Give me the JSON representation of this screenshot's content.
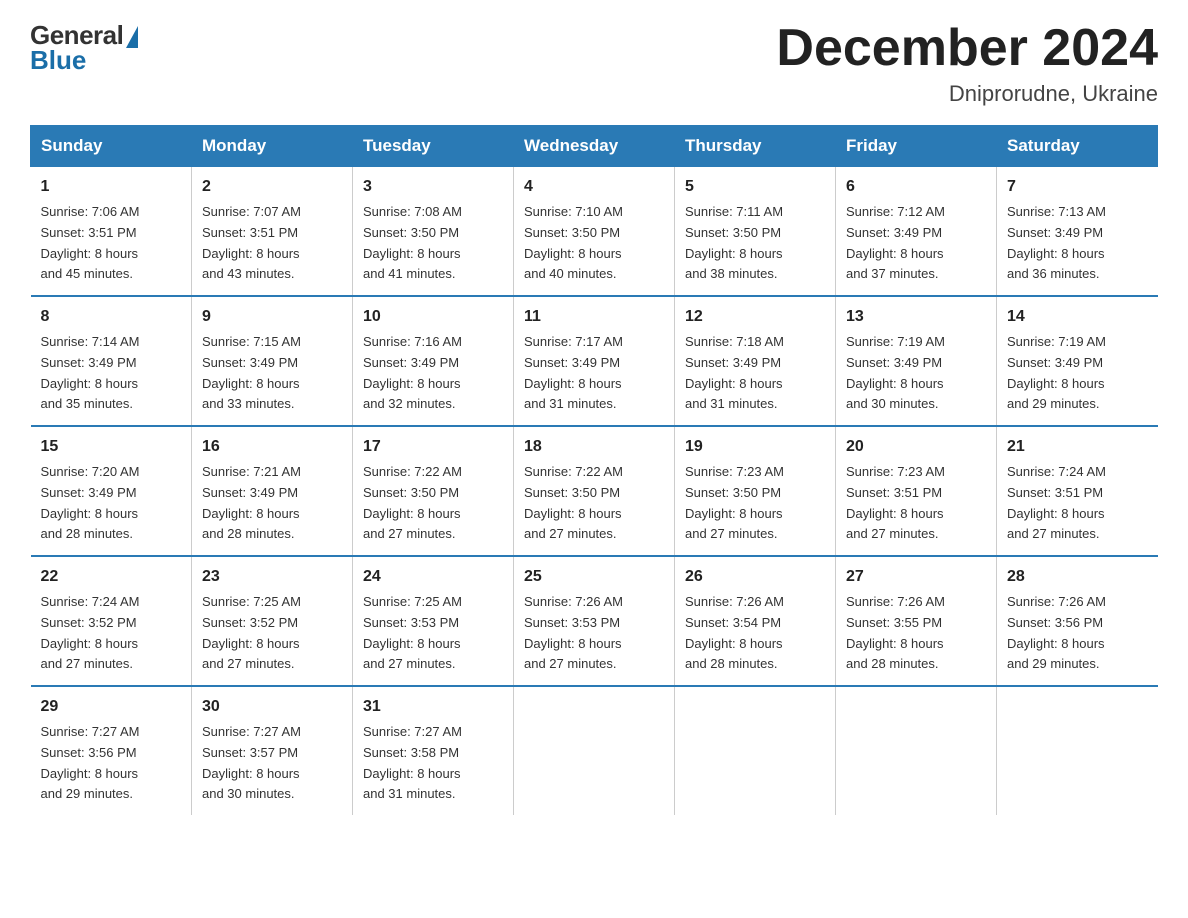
{
  "logo": {
    "general": "General",
    "blue": "Blue"
  },
  "header": {
    "month_year": "December 2024",
    "location": "Dniprorudne, Ukraine"
  },
  "days_of_week": [
    "Sunday",
    "Monday",
    "Tuesday",
    "Wednesday",
    "Thursday",
    "Friday",
    "Saturday"
  ],
  "weeks": [
    [
      {
        "day": "1",
        "sunrise": "7:06 AM",
        "sunset": "3:51 PM",
        "daylight": "8 hours and 45 minutes."
      },
      {
        "day": "2",
        "sunrise": "7:07 AM",
        "sunset": "3:51 PM",
        "daylight": "8 hours and 43 minutes."
      },
      {
        "day": "3",
        "sunrise": "7:08 AM",
        "sunset": "3:50 PM",
        "daylight": "8 hours and 41 minutes."
      },
      {
        "day": "4",
        "sunrise": "7:10 AM",
        "sunset": "3:50 PM",
        "daylight": "8 hours and 40 minutes."
      },
      {
        "day": "5",
        "sunrise": "7:11 AM",
        "sunset": "3:50 PM",
        "daylight": "8 hours and 38 minutes."
      },
      {
        "day": "6",
        "sunrise": "7:12 AM",
        "sunset": "3:49 PM",
        "daylight": "8 hours and 37 minutes."
      },
      {
        "day": "7",
        "sunrise": "7:13 AM",
        "sunset": "3:49 PM",
        "daylight": "8 hours and 36 minutes."
      }
    ],
    [
      {
        "day": "8",
        "sunrise": "7:14 AM",
        "sunset": "3:49 PM",
        "daylight": "8 hours and 35 minutes."
      },
      {
        "day": "9",
        "sunrise": "7:15 AM",
        "sunset": "3:49 PM",
        "daylight": "8 hours and 33 minutes."
      },
      {
        "day": "10",
        "sunrise": "7:16 AM",
        "sunset": "3:49 PM",
        "daylight": "8 hours and 32 minutes."
      },
      {
        "day": "11",
        "sunrise": "7:17 AM",
        "sunset": "3:49 PM",
        "daylight": "8 hours and 31 minutes."
      },
      {
        "day": "12",
        "sunrise": "7:18 AM",
        "sunset": "3:49 PM",
        "daylight": "8 hours and 31 minutes."
      },
      {
        "day": "13",
        "sunrise": "7:19 AM",
        "sunset": "3:49 PM",
        "daylight": "8 hours and 30 minutes."
      },
      {
        "day": "14",
        "sunrise": "7:19 AM",
        "sunset": "3:49 PM",
        "daylight": "8 hours and 29 minutes."
      }
    ],
    [
      {
        "day": "15",
        "sunrise": "7:20 AM",
        "sunset": "3:49 PM",
        "daylight": "8 hours and 28 minutes."
      },
      {
        "day": "16",
        "sunrise": "7:21 AM",
        "sunset": "3:49 PM",
        "daylight": "8 hours and 28 minutes."
      },
      {
        "day": "17",
        "sunrise": "7:22 AM",
        "sunset": "3:50 PM",
        "daylight": "8 hours and 27 minutes."
      },
      {
        "day": "18",
        "sunrise": "7:22 AM",
        "sunset": "3:50 PM",
        "daylight": "8 hours and 27 minutes."
      },
      {
        "day": "19",
        "sunrise": "7:23 AM",
        "sunset": "3:50 PM",
        "daylight": "8 hours and 27 minutes."
      },
      {
        "day": "20",
        "sunrise": "7:23 AM",
        "sunset": "3:51 PM",
        "daylight": "8 hours and 27 minutes."
      },
      {
        "day": "21",
        "sunrise": "7:24 AM",
        "sunset": "3:51 PM",
        "daylight": "8 hours and 27 minutes."
      }
    ],
    [
      {
        "day": "22",
        "sunrise": "7:24 AM",
        "sunset": "3:52 PM",
        "daylight": "8 hours and 27 minutes."
      },
      {
        "day": "23",
        "sunrise": "7:25 AM",
        "sunset": "3:52 PM",
        "daylight": "8 hours and 27 minutes."
      },
      {
        "day": "24",
        "sunrise": "7:25 AM",
        "sunset": "3:53 PM",
        "daylight": "8 hours and 27 minutes."
      },
      {
        "day": "25",
        "sunrise": "7:26 AM",
        "sunset": "3:53 PM",
        "daylight": "8 hours and 27 minutes."
      },
      {
        "day": "26",
        "sunrise": "7:26 AM",
        "sunset": "3:54 PM",
        "daylight": "8 hours and 28 minutes."
      },
      {
        "day": "27",
        "sunrise": "7:26 AM",
        "sunset": "3:55 PM",
        "daylight": "8 hours and 28 minutes."
      },
      {
        "day": "28",
        "sunrise": "7:26 AM",
        "sunset": "3:56 PM",
        "daylight": "8 hours and 29 minutes."
      }
    ],
    [
      {
        "day": "29",
        "sunrise": "7:27 AM",
        "sunset": "3:56 PM",
        "daylight": "8 hours and 29 minutes."
      },
      {
        "day": "30",
        "sunrise": "7:27 AM",
        "sunset": "3:57 PM",
        "daylight": "8 hours and 30 minutes."
      },
      {
        "day": "31",
        "sunrise": "7:27 AM",
        "sunset": "3:58 PM",
        "daylight": "8 hours and 31 minutes."
      },
      {
        "day": "",
        "sunrise": "",
        "sunset": "",
        "daylight": ""
      },
      {
        "day": "",
        "sunrise": "",
        "sunset": "",
        "daylight": ""
      },
      {
        "day": "",
        "sunrise": "",
        "sunset": "",
        "daylight": ""
      },
      {
        "day": "",
        "sunrise": "",
        "sunset": "",
        "daylight": ""
      }
    ]
  ],
  "labels": {
    "sunrise": "Sunrise:",
    "sunset": "Sunset:",
    "daylight": "Daylight:"
  }
}
